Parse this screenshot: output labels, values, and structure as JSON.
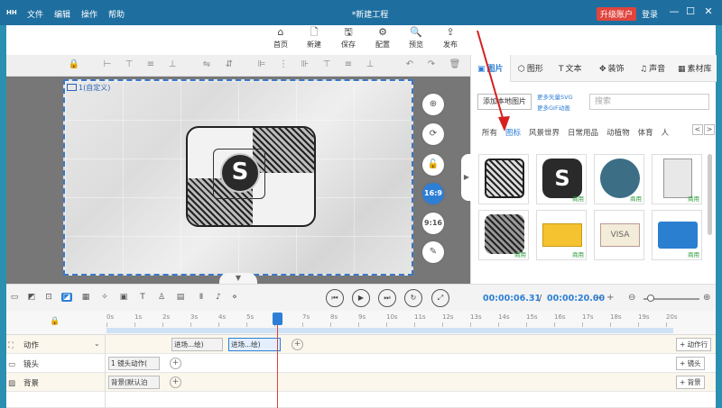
{
  "titlebar": {
    "logo": "HH",
    "menu": [
      "文件",
      "编辑",
      "操作",
      "帮助"
    ],
    "doc_title": "*新建工程",
    "upgrade": "升级账户",
    "login": "登录",
    "min": "—",
    "max": "☐",
    "close": "✕"
  },
  "toolbar": [
    {
      "icon": "home-icon",
      "glyph": "⌂",
      "label": "首页"
    },
    {
      "icon": "new-file-icon",
      "glyph": "🗋",
      "label": "新建"
    },
    {
      "icon": "save-icon",
      "glyph": "🖫",
      "label": "保存"
    },
    {
      "icon": "config-icon",
      "glyph": "⚙",
      "label": "配置"
    },
    {
      "icon": "preview-icon",
      "glyph": "🔍",
      "label": "预览"
    },
    {
      "icon": "publish-icon",
      "glyph": "⇪",
      "label": "发布"
    }
  ],
  "stage": {
    "label": "1(自定义)"
  },
  "logo_letter": "S",
  "side_buttons": {
    "ratio_169": "16:9",
    "ratio_916": "9:16"
  },
  "right_panel": {
    "tabs": [
      {
        "glyph": "▣",
        "label": "图片",
        "active": true
      },
      {
        "glyph": "⬡",
        "label": "图形"
      },
      {
        "glyph": "T",
        "label": "文本"
      },
      {
        "glyph": "✥",
        "label": "装饰"
      },
      {
        "glyph": "♫",
        "label": "声音"
      },
      {
        "glyph": "▦",
        "label": "素材库"
      }
    ],
    "local_button": "添加本地图片",
    "more_svg": "更多矢量SVG",
    "more_gif": "更多GIF动画",
    "search_placeholder": "搜索",
    "categories": [
      "所有",
      "图标",
      "风景世界",
      "日常用品",
      "动植物",
      "体育",
      "人"
    ],
    "active_category": "图标",
    "cat_prev": "<",
    "cat_next": ">",
    "thumb_tag": "商用"
  },
  "timeline": {
    "current_time": "00:00:06.31",
    "separator": "/",
    "total_time": "00:00:20.00",
    "minus": "—",
    "plus": "+",
    "ruler": [
      "0s",
      "1s",
      "2s",
      "3s",
      "4s",
      "5s",
      "6s",
      "7s",
      "8s",
      "9s",
      "10s",
      "11s",
      "12s",
      "13s",
      "14s",
      "15s",
      "16s",
      "17s",
      "18s",
      "19s",
      "20s"
    ],
    "tracks": [
      {
        "name": "动作",
        "icon": "action-icon",
        "glyph": "⛶",
        "add_label": "+ 动作行"
      },
      {
        "name": "镜头",
        "icon": "camera-icon",
        "glyph": "▭",
        "add_label": "+ 镜头"
      },
      {
        "name": "背景",
        "icon": "background-icon",
        "glyph": "▨",
        "add_label": "+ 背景"
      }
    ],
    "clips": {
      "action_1": "进场...绘)",
      "action_2": "进场...绘)",
      "camera_1": "1 镜头动作(",
      "background_1": "背景(默认泊"
    }
  }
}
